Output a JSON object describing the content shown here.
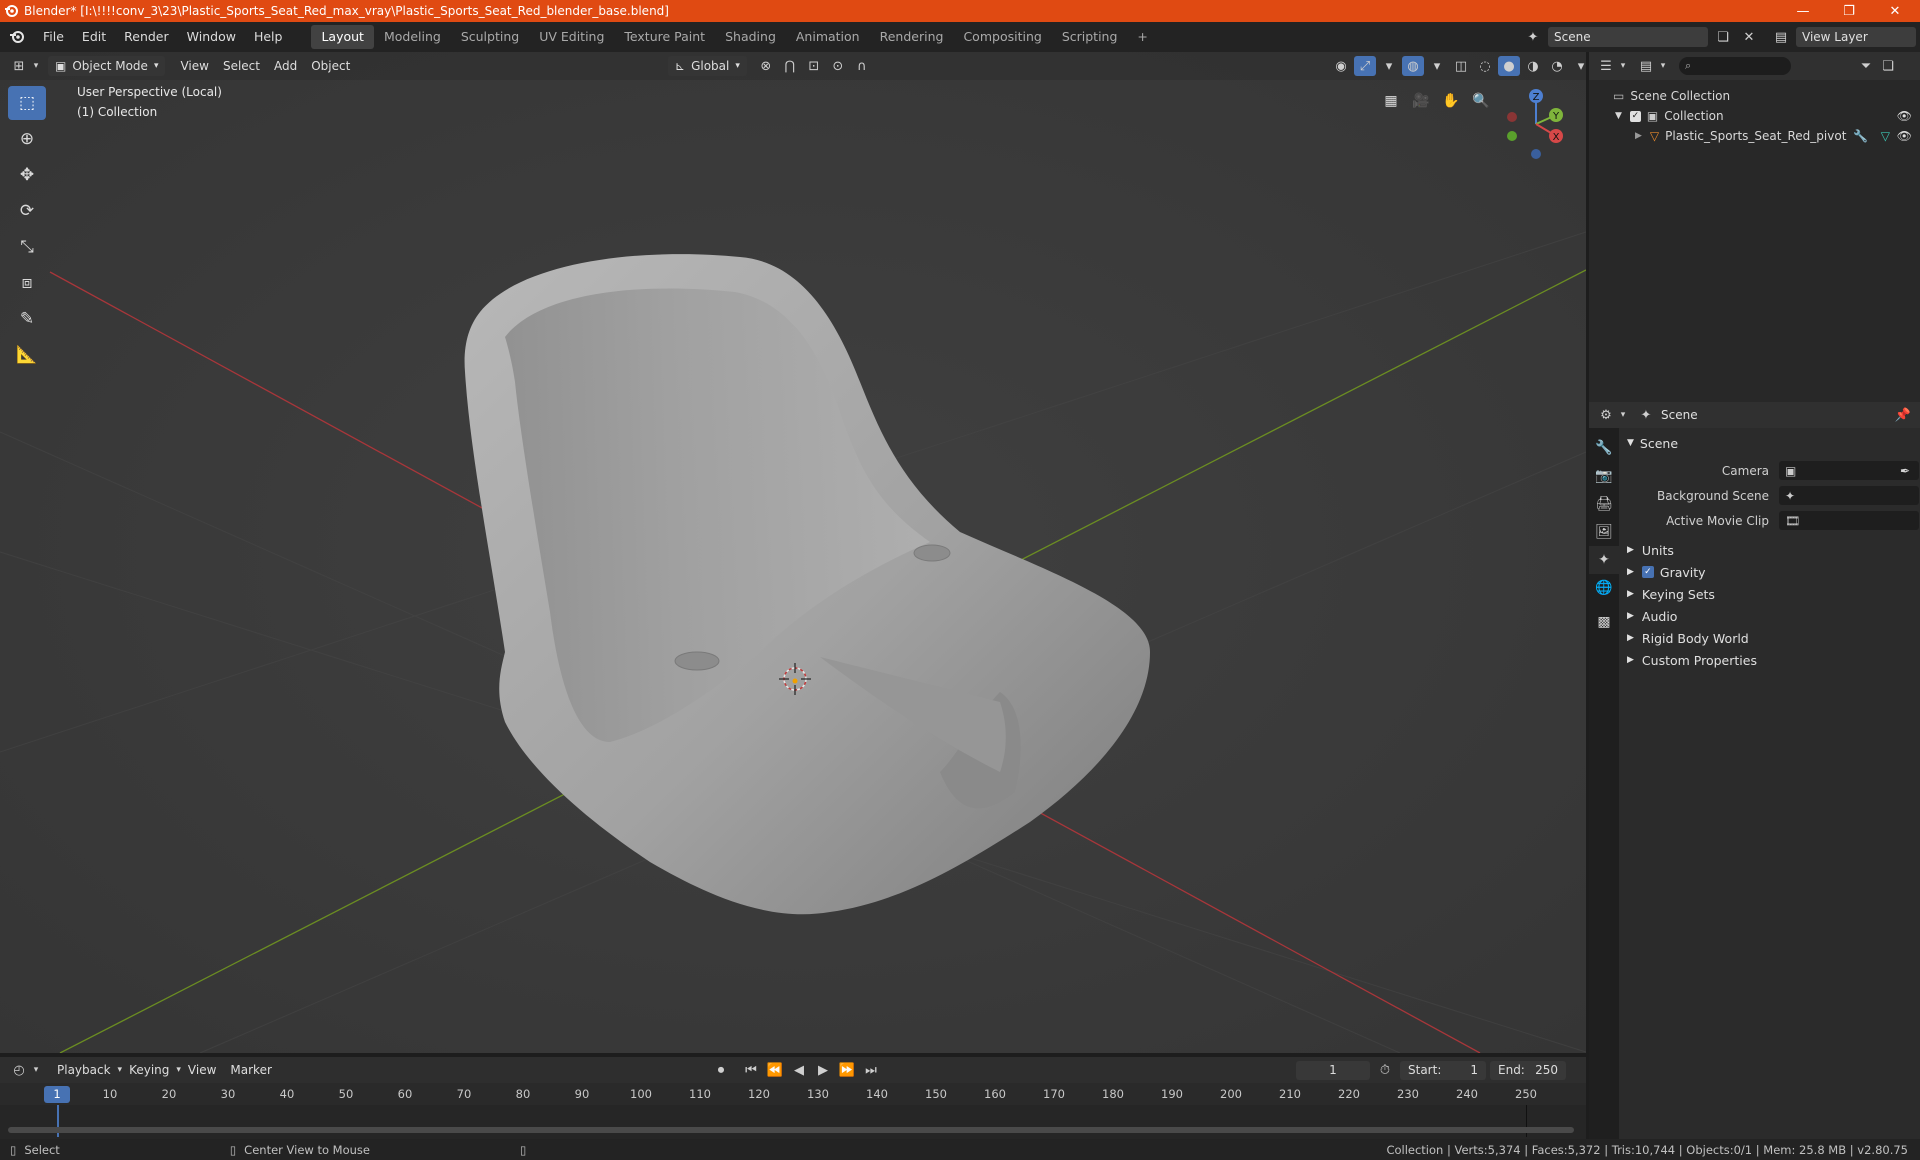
{
  "titlebar": {
    "text": "Blender* [I:\\!!!!conv_3\\23\\Plastic_Sports_Seat_Red_max_vray\\Plastic_Sports_Seat_Red_blender_base.blend]",
    "minimize": "—",
    "restore": "❐",
    "close": "✕"
  },
  "menu": {
    "file": "File",
    "edit": "Edit",
    "render": "Render",
    "window": "Window",
    "help": "Help"
  },
  "workspaces": [
    "Layout",
    "Modeling",
    "Sculpting",
    "UV Editing",
    "Texture Paint",
    "Shading",
    "Animation",
    "Rendering",
    "Compositing",
    "Scripting"
  ],
  "workspace_add": "+",
  "scene_selector": "Scene",
  "view_layer": "View Layer",
  "viewport_header": {
    "mode": "Object Mode",
    "view": "View",
    "select": "Select",
    "add": "Add",
    "object": "Object",
    "orientation": "Global"
  },
  "viewport_info": {
    "line1": "User Perspective (Local)",
    "line2": "(1) Collection"
  },
  "gizmo": {
    "x": "X",
    "y": "Y",
    "z": "Z"
  },
  "outliner": {
    "search_placeholder": "",
    "scene_collection": "Scene Collection",
    "collection": "Collection",
    "object": "Plastic_Sports_Seat_Red_pivot"
  },
  "properties": {
    "context": "Scene",
    "section": "Scene",
    "camera_label": "Camera",
    "background_label": "Background Scene",
    "movieclip_label": "Active Movie Clip",
    "subsections": [
      "Units",
      "Gravity",
      "Keying Sets",
      "Audio",
      "Rigid Body World",
      "Custom Properties"
    ],
    "gravity_enabled": true
  },
  "timeline": {
    "playback": "Playback",
    "keying": "Keying",
    "view": "View",
    "marker": "Marker",
    "current_frame": "1",
    "start_label": "Start:",
    "start": "1",
    "end_label": "End:",
    "end": "250",
    "ticks": [
      "10",
      "20",
      "30",
      "40",
      "50",
      "60",
      "70",
      "80",
      "90",
      "100",
      "110",
      "120",
      "130",
      "140",
      "150",
      "160",
      "170",
      "180",
      "190",
      "200",
      "210",
      "220",
      "230",
      "240",
      "250"
    ],
    "ruler_current": "1"
  },
  "status": {
    "select": "Select",
    "center": "Center View to Mouse",
    "stats": "Collection | Verts:5,374 | Faces:5,372 | Tris:10,744 | Objects:0/1 | Mem: 25.8 MB | v2.80.75"
  }
}
